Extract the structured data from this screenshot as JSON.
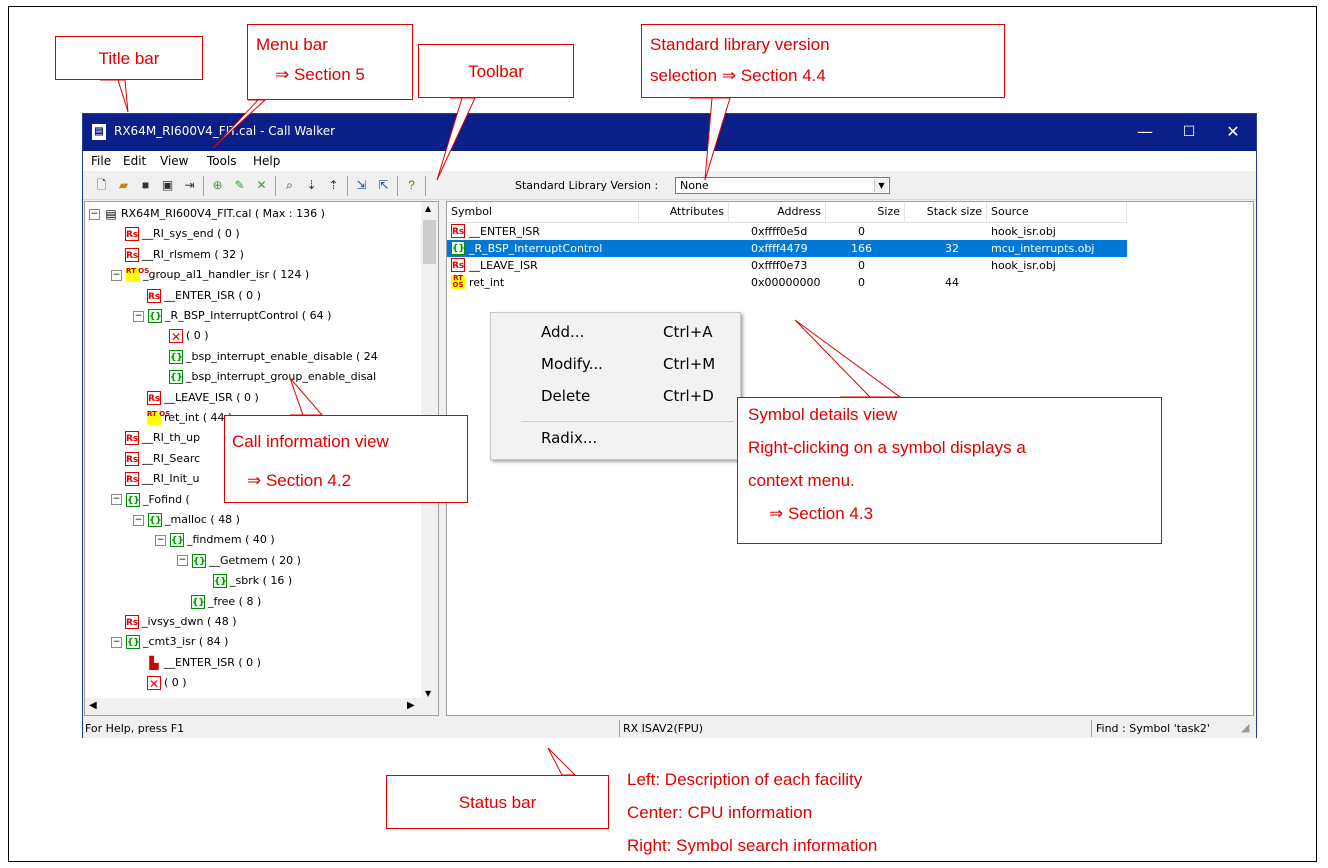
{
  "window": {
    "title": "RX64M_RI600V4_FIT.cal - Call Walker",
    "controls": [
      "—",
      "☐",
      "✕"
    ]
  },
  "menu": [
    "File",
    "Edit",
    "View",
    "Tools",
    "Help"
  ],
  "toolbar": {
    "std_label": "Standard Library Version :",
    "std_value": "None"
  },
  "tree": [
    {
      "label": "RX64M_RI600V4_FIT.cal ( Max : 136 )",
      "icon": "document-icon",
      "depth": 0,
      "expander": "−"
    },
    {
      "label": "__RI_sys_end ( 0 )",
      "icon": "rs-icon",
      "depth": 1
    },
    {
      "label": "__RI_rlsmem ( 32 )",
      "icon": "rs-icon",
      "depth": 1
    },
    {
      "label": "_group_al1_handler_isr ( 124 )",
      "icon": "rtos-icon",
      "depth": 1,
      "expander": "−"
    },
    {
      "label": "__ENTER_ISR ( 0 )",
      "icon": "rs-icon",
      "depth": 2
    },
    {
      "label": "_R_BSP_InterruptControl ( 64 )",
      "icon": "function-icon",
      "depth": 2,
      "expander": "−"
    },
    {
      "label": "( 0 )",
      "icon": "missing-icon",
      "depth": 3
    },
    {
      "label": "_bsp_interrupt_enable_disable ( 24",
      "icon": "function-icon",
      "depth": 3
    },
    {
      "label": "_bsp_interrupt_group_enable_disal",
      "icon": "function-icon",
      "depth": 3
    },
    {
      "label": "__LEAVE_ISR ( 0 )",
      "icon": "rs-icon",
      "depth": 2
    },
    {
      "label": "ret_int ( 44 )",
      "icon": "rtos-icon",
      "depth": 2
    },
    {
      "label": "__RI_th_up",
      "icon": "rs-icon",
      "depth": 1
    },
    {
      "label": "__RI_Searc",
      "icon": "rs-icon",
      "depth": 1
    },
    {
      "label": "__RI_Init_u",
      "icon": "rs-icon",
      "depth": 1
    },
    {
      "label": "_Fofind (",
      "icon": "function-icon",
      "depth": 1,
      "expander": "−"
    },
    {
      "label": "_malloc ( 48 )",
      "icon": "function-icon",
      "depth": 2,
      "expander": "−"
    },
    {
      "label": "_findmem ( 40 )",
      "icon": "function-icon",
      "depth": 3,
      "expander": "−"
    },
    {
      "label": "__Getmem ( 20 )",
      "icon": "function-icon",
      "depth": 4,
      "expander": "−"
    },
    {
      "label": "_sbrk ( 16 )",
      "icon": "function-icon",
      "depth": 5
    },
    {
      "label": "_free ( 8 )",
      "icon": "function-icon",
      "depth": 4
    },
    {
      "label": "_ivsys_dwn ( 48 )",
      "icon": "rs-icon",
      "depth": 1
    },
    {
      "label": "_cmt3_isr ( 84 )",
      "icon": "function-icon",
      "depth": 1,
      "expander": "−"
    },
    {
      "label": "__ENTER_ISR ( 0 )",
      "icon": "task-stack-icon",
      "depth": 2
    },
    {
      "label": "( 0 )",
      "icon": "missing-icon",
      "depth": 2
    }
  ],
  "table": {
    "headers": [
      "Symbol",
      "Attributes",
      "Address",
      "Size",
      "Stack size",
      "Source"
    ],
    "rows": [
      {
        "icon": "rs-icon",
        "symbol": "__ENTER_ISR",
        "attributes": "",
        "address": "0xffff0e5d",
        "size": "0",
        "stack": "",
        "source": "hook_isr.obj",
        "selected": false
      },
      {
        "icon": "function-icon",
        "symbol": "_R_BSP_InterruptControl",
        "attributes": "",
        "address": "0xffff4479",
        "size": "166",
        "stack": "32",
        "source": "mcu_interrupts.obj",
        "selected": true
      },
      {
        "icon": "rs-icon",
        "symbol": "__LEAVE_ISR",
        "attributes": "",
        "address": "0xffff0e73",
        "size": "0",
        "stack": "",
        "source": "hook_isr.obj",
        "selected": false
      },
      {
        "icon": "rtos-icon",
        "symbol": "ret_int",
        "attributes": "",
        "address": "0x00000000",
        "size": "0",
        "stack": "44",
        "source": "",
        "selected": false
      }
    ]
  },
  "context_menu": {
    "items": [
      {
        "label": "Add...",
        "shortcut": "Ctrl+A"
      },
      {
        "label": "Modify...",
        "shortcut": "Ctrl+M"
      },
      {
        "label": "Delete",
        "shortcut": "Ctrl+D"
      },
      {
        "label": "Radix...",
        "shortcut": ""
      }
    ]
  },
  "status": {
    "left": "For Help, press F1",
    "center": "RX ISAV2(FPU)",
    "right": "Find : Symbol 'task2'"
  },
  "callouts": {
    "title_bar": "Title bar",
    "menu_bar_1": "Menu bar",
    "menu_bar_2": "⇒ Section 5",
    "toolbar": "Toolbar",
    "stdlib_1": "Standard library version",
    "stdlib_2": "selection ⇒ Section 4.4",
    "callinfo_1": "Call information view",
    "callinfo_2": "⇒ Section 4.2",
    "symdetail_1": "Symbol details view",
    "symdetail_2": "Right-clicking on a symbol displays a",
    "symdetail_3": "context menu.",
    "symdetail_4": "⇒ Section 4.3",
    "status_bar": "Status bar",
    "status_desc_1": "Left: Description of each facility",
    "status_desc_2": "Center: CPU information",
    "status_desc_3": "Right: Symbol search information"
  }
}
